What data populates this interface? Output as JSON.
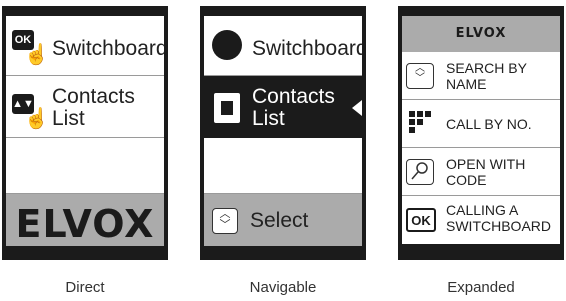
{
  "direct": {
    "caption": "Direct",
    "item1": {
      "label": "Switchboard",
      "key": "OK"
    },
    "item2": {
      "label_line1": "Contacts",
      "label_line2": "List",
      "key": "up-down"
    },
    "logo": "ELVOX"
  },
  "navigable": {
    "caption": "Navigable",
    "item1": {
      "label": "Switchboard"
    },
    "item2": {
      "label_line1": "Contacts",
      "label_line2": "List"
    },
    "select_label": "Select"
  },
  "expanded": {
    "caption": "Expanded",
    "logo": "ELVOX",
    "items": [
      {
        "line1": "SEARCH BY",
        "line2": "NAME",
        "icon": "up-down-arrows-icon"
      },
      {
        "line1": "CALL BY NO.",
        "line2": "",
        "icon": "keypad-icon"
      },
      {
        "line1": "OPEN WITH",
        "line2": "CODE",
        "icon": "key-icon"
      },
      {
        "line1": "CALLING A",
        "line2": "SWITCHBOARD",
        "icon": "ok-icon"
      }
    ],
    "ok_key": "OK"
  }
}
